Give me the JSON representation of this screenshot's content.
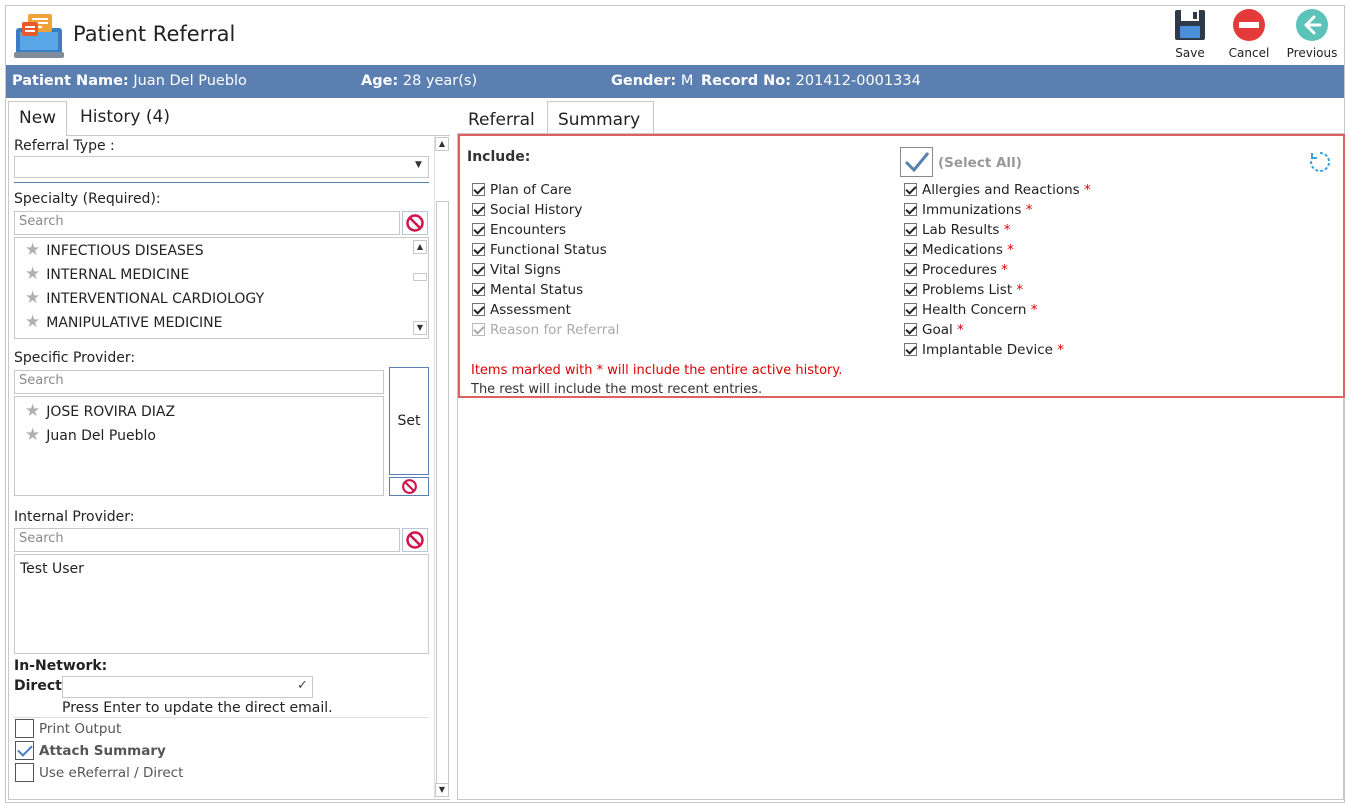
{
  "window": {
    "title": "Patient Referral",
    "toolbar": {
      "save_label": "Save",
      "cancel_label": "Cancel",
      "previous_label": "Previous"
    }
  },
  "patient_bar": {
    "name_label": "Patient Name:",
    "name_value": "Juan Del Pueblo",
    "age_label": "Age:",
    "age_value": "28 year(s)",
    "gender_label": "Gender:",
    "gender_value": "M",
    "record_label": "Record No:",
    "record_value": "201412-0001334"
  },
  "left_tabs": {
    "new": "New",
    "history": "History",
    "history_count": "(4)"
  },
  "referral_type": {
    "label": "Referral Type :",
    "value": ""
  },
  "specialty": {
    "label": "Specialty (Required):",
    "search_placeholder": "Search",
    "items": [
      "INFECTIOUS DISEASES",
      "INTERNAL MEDICINE",
      "INTERVENTIONAL CARDIOLOGY",
      "MANIPULATIVE MEDICINE"
    ]
  },
  "specific_provider": {
    "label": "Specific Provider:",
    "search_placeholder": "Search",
    "items": [
      "JOSE ROVIRA DIAZ",
      "Juan  Del Pueblo"
    ],
    "set_label": "Set"
  },
  "internal_provider": {
    "label": "Internal Provider:",
    "search_placeholder": "Search",
    "items": [
      "Test User"
    ]
  },
  "in_network": {
    "label": "In-Network:",
    "direct_label": "Direct:",
    "direct_value": "",
    "hint": "Press Enter to update the direct email."
  },
  "options": {
    "print_output": {
      "label": "Print Output",
      "checked": false
    },
    "attach_summary": {
      "label": "Attach Summary",
      "checked": true
    },
    "use_ereferral": {
      "label": "Use eReferral / Direct",
      "checked": false
    }
  },
  "right_tabs": {
    "referral": "Referral",
    "summary": "Summary"
  },
  "summary": {
    "include_label": "Include:",
    "select_all_label": "(Select All)",
    "left_items": [
      "Plan of Care",
      "Social History",
      "Encounters",
      "Functional Status",
      "Vital Signs",
      "Mental Status",
      "Assessment",
      "Reason for Referral"
    ],
    "right_items": [
      "Allergies and Reactions",
      "Immunizations",
      "Lab Results",
      "Medications",
      "Procedures",
      "Problems List",
      "Health Concern",
      "Goal",
      "Implantable Device"
    ],
    "required_marker": "*",
    "note_red": "Items marked with * will include the entire active history.",
    "note_black": "The rest will include the most recent entries."
  },
  "colors": {
    "accent_bar": "#5a7fb0",
    "highlight_border": "#e06060",
    "required": "#dd0000"
  }
}
